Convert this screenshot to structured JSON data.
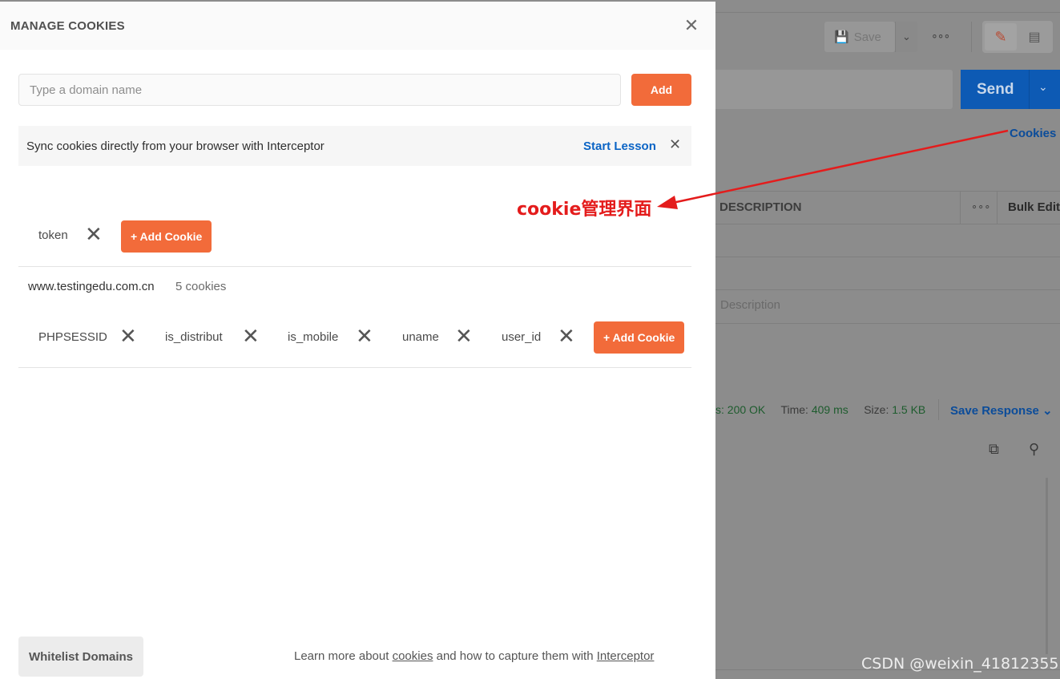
{
  "background": {
    "save_label": "Save",
    "send_label": "Send",
    "cookies_link": "Cookies",
    "table_header_description": "DESCRIPTION",
    "bulk_edit": "Bulk Edit",
    "description_placeholder": "Description",
    "status_prefix": "s:",
    "status_value": "200 OK",
    "time_label": "Time:",
    "time_value": "409 ms",
    "size_label": "Size:",
    "size_value": "1.5 KB",
    "save_response": "Save Response"
  },
  "modal": {
    "title": "MANAGE COOKIES",
    "domain_input_placeholder": "Type a domain name",
    "domain_input_value": "",
    "add_label": "Add",
    "banner_text": "Sync cookies directly from your browser with Interceptor",
    "banner_link": "Start Lesson",
    "add_cookie_label": "+ Add Cookie",
    "groups": [
      {
        "domain": "",
        "count": "",
        "cookies": [
          "token"
        ]
      },
      {
        "domain": "www.testingedu.com.cn",
        "count": "5 cookies",
        "cookies": [
          "PHPSESSID",
          "is_distribut",
          "is_mobile",
          "uname",
          "user_id"
        ]
      }
    ],
    "whitelist_label": "Whitelist Domains",
    "footer_prefix": "Learn more about ",
    "footer_link1": "cookies",
    "footer_middle": " and how to capture them with ",
    "footer_link2": "Interceptor"
  },
  "annotation": {
    "label": "cookie管理界面",
    "color": "#e41c1c"
  },
  "watermark": "CSDN @weixin_41812355",
  "colors": {
    "accent": "#f26b3a",
    "link": "#0b64c5",
    "send": "#0d5ab4"
  }
}
